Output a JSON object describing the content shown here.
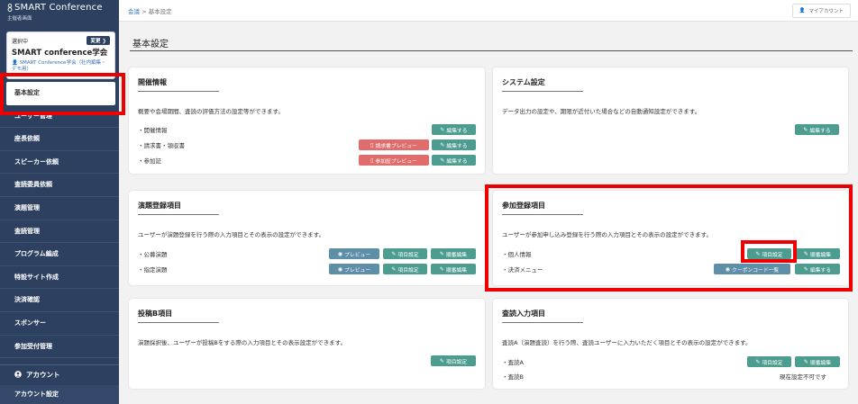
{
  "sidebar": {
    "brand_title": "SMART Conference",
    "brand_sub": "主催者画面",
    "conf_selected_label": "選択中",
    "conf_change_label": "変更",
    "conf_name": "SMART conference学会",
    "conf_association": "SMART Conference学会（社内編集・デモ用）",
    "nav_items": [
      "基本設定",
      "ユーザー管理",
      "座長依頼",
      "スピーカー依頼",
      "査読委員依頼",
      "演題管理",
      "査読管理",
      "プログラム編成",
      "特設サイト作成",
      "決済確認",
      "スポンサー",
      "参加受付管理"
    ],
    "account_head": "アカウント",
    "account_item": "アカウント設定"
  },
  "header": {
    "breadcrumb_home": "会議",
    "breadcrumb_sep": ">",
    "breadcrumb_current": "基本設定",
    "account_label": "マイアカウント"
  },
  "page_title": "基本設定",
  "cards": {
    "event": {
      "title": "開催情報",
      "desc": "概要や会場期間、査読の評価方法の設定等ができます。",
      "items": [
        "・開催情報",
        "・請求書・領収書",
        "・参加証"
      ],
      "edit": "編集する",
      "invoice_preview": "請求書プレビュー",
      "cert_preview": "参加証プレビュー"
    },
    "system": {
      "title": "システム設定",
      "desc": "データ出力の設定や、期限が近付いた場合などの自動通知設定ができます。",
      "edit": "編集する"
    },
    "abstract": {
      "title": "演題登録項目",
      "desc": "ユーザーが演題登録を行う際の入力項目とその表示の設定ができます。",
      "items": [
        "・公募演題",
        "・指定演題"
      ],
      "preview": "プレビュー",
      "fields": "項目設定",
      "order": "順番編集"
    },
    "participant": {
      "title": "参加登録項目",
      "desc": "ユーザーが参加申し込み登録を行う際の入力項目とその表示の設定ができます。",
      "items": [
        "・個人情報",
        "・決済メニュー"
      ],
      "fields": "項目設定",
      "order": "順番編集",
      "coupon": "クーポンコード一覧",
      "edit": "編集する"
    },
    "post_b": {
      "title": "投稿B項目",
      "desc": "演題採択後、ユーザーが投稿Bをする際の入力項目とその表示設定ができます。",
      "fields": "項目設定"
    },
    "review": {
      "title": "査読入力項目",
      "desc": "査読A（演題査読）を行う際、査読ユーザーに入力いただく項目とその表示の設定ができます。",
      "items": [
        "・査読A",
        "・査読B"
      ],
      "fields": "項目設定",
      "order": "順番編集",
      "unavailable": "現在設定不可です"
    }
  },
  "colors": {
    "sidebar_bg": "#2d4060",
    "teal_button": "#4c9d90",
    "pink_button": "#e06c6c",
    "highlight_red": "#ee0000"
  }
}
